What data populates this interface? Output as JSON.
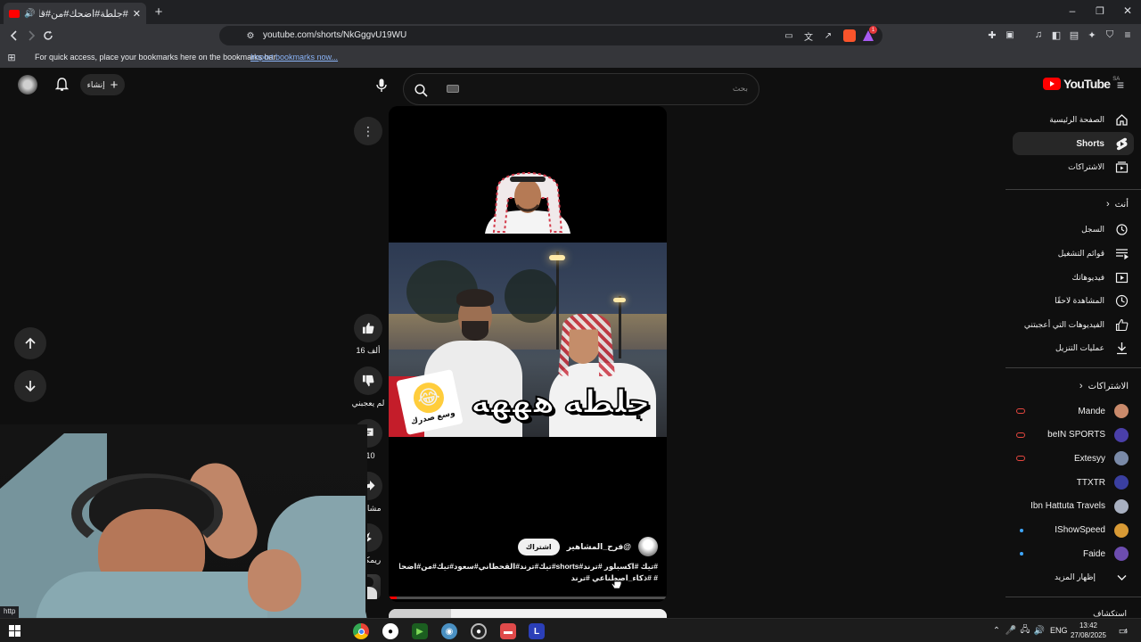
{
  "browser": {
    "tab_title": "#جلطة#اضحك#من#قلبك#سد...",
    "url": "youtube.com/shorts/NkGggvU19WU",
    "bookmarks_hint": "For quick access, place your bookmarks here on the bookmarks bar.",
    "import_bookmarks": "Import bookmarks now...",
    "brave_badge": "1"
  },
  "youtube": {
    "create_label": "إنشاء",
    "search_placeholder": "بحث",
    "logo_text": "YouTube",
    "region": "SA",
    "nav": {
      "home": "الصفحة الرئيسية",
      "shorts": "Shorts",
      "subscriptions": "الاشتراكات"
    },
    "you_header": "أنت",
    "you_items": {
      "history": "السجل",
      "playlists": "قوائم التشغيل",
      "your_videos": "فيديوهاتك",
      "watch_later": "المشاهدة لاحقًا",
      "liked_videos": "الفيديوهات التي أعجبتني",
      "downloads": "عمليات التنزيل"
    },
    "subs_header": "الاشتراكات",
    "subscriptions": [
      {
        "name": "Mande",
        "live": true
      },
      {
        "name": "beIN SPORTS",
        "live": true
      },
      {
        "name": "Extesyy",
        "live": true
      },
      {
        "name": "TTXTR",
        "live": false
      },
      {
        "name": "Ibn Hattuta Travels",
        "live": false
      },
      {
        "name": "IShowSpeed",
        "live": false,
        "dot": true
      },
      {
        "name": "Faide",
        "live": false,
        "dot": true
      }
    ],
    "show_more": "إظهار المزيد",
    "explore": "استكشاف"
  },
  "short": {
    "caption_overlay": "جلطه هههه",
    "sticker_text": "وسع صدرك",
    "channel_handle": "@فرح_المشاهير",
    "subscribe_label": "اشتراك",
    "description_line1": "#تيك #اكسبلور #ترند#shorts#تيك#ترند#القحطاني#سعود#تيك#من#اضحك#جلطة",
    "description_line2": "# #ذكاء_اصطناعي #ترند",
    "likes": "16 ألف",
    "dislike_label": "لم يعجبني",
    "comments": "410",
    "share_label": "مشاركة",
    "remix_label": "ريمكس",
    "progress": 0.03
  },
  "status_bar": {
    "text": "http"
  },
  "taskbar": {
    "language": "ENG",
    "time": "13:42",
    "date": "27/08/2025",
    "notifications": "4"
  },
  "colors": {
    "youtube_red": "#ff0000",
    "live_red": "#ff4e45",
    "link_blue": "#8ab4f8",
    "panel_bg": "#0f0f0f"
  }
}
